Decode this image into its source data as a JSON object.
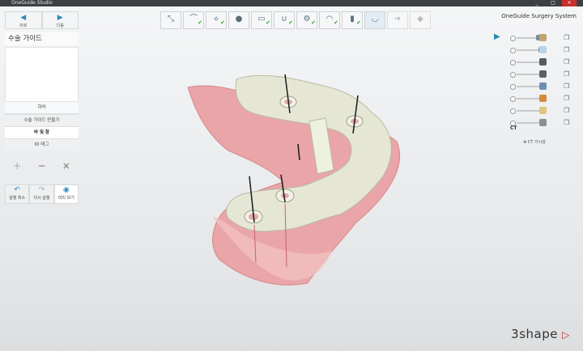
{
  "window": {
    "title": "OneGuide Studio"
  },
  "nav": {
    "back_label": "뒤로",
    "next_label": "다음"
  },
  "panel": {
    "title": "수술 가이드",
    "thumb_caption": "하악",
    "steps": [
      "수술 가이드 만들기",
      "바 및 창",
      "ID 태그"
    ],
    "active_step": 1
  },
  "tools": {
    "add": "+",
    "remove": "−",
    "close": "×"
  },
  "actions": {
    "undo": "실행 취소",
    "redo": "다시 실행",
    "view": "미리 보기"
  },
  "toolbar": {
    "items": [
      "ruler-icon",
      "scan-icon",
      "model-icon",
      "tooth-icon",
      "bite-icon",
      "gum-icon",
      "implant-icon",
      "drill-icon",
      "sleeve-icon",
      "guide-icon",
      "arrow-icon",
      "cube-icon"
    ]
  },
  "right": {
    "app_title": "OneGuide Surgery System",
    "layers": [
      {
        "level": 0.8,
        "color": "#c2a36e"
      },
      {
        "level": 0.9,
        "color": "#b9d2e6"
      },
      {
        "level": 0.95,
        "color": "#555b61"
      },
      {
        "level": 0.95,
        "color": "#5a6068"
      },
      {
        "level": 0.95,
        "color": "#6c8eb0"
      },
      {
        "level": 0.95,
        "color": "#d58a3a"
      },
      {
        "level": 0.95,
        "color": "#e0c47d"
      },
      {
        "level": 0.95,
        "color": "#8a8f95"
      }
    ],
    "ct_label": "CT",
    "ct_visible_label": "CT 가시성"
  },
  "logo": {
    "text": "3shape"
  },
  "colors": {
    "accent": "#2a8bb7",
    "gum": "#e8a3a6",
    "guide": "#e4e6d3",
    "brand": "#c8282d"
  }
}
